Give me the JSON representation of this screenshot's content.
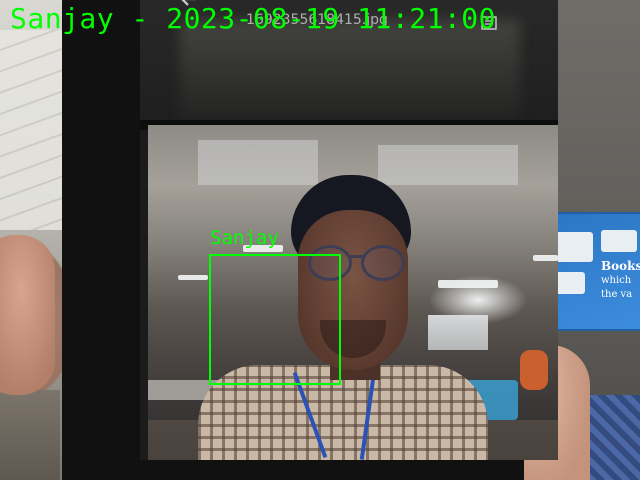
{
  "overlay": {
    "timestamp_text": "Sanjay - 2023-08-19 11:21:00",
    "face_label": "Sanjay",
    "overlay_color": "#00ff00"
  },
  "phone_screen": {
    "file_name": "1692355618415.jpg",
    "back_icon": "back-arrow-icon",
    "menu_icon": "document-menu-icon"
  },
  "poster": {
    "text_line1": "Books",
    "text_line2": "which",
    "text_line3": "the va"
  }
}
